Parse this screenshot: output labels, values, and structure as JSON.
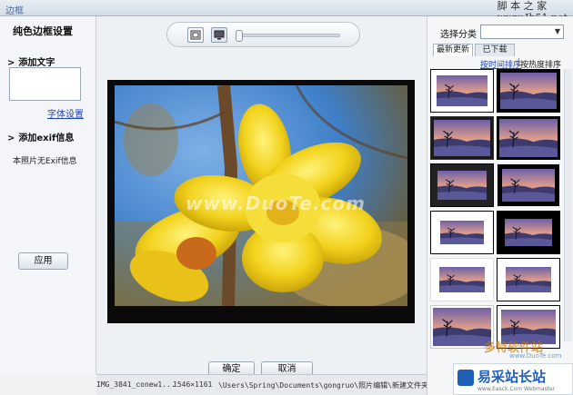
{
  "window": {
    "title": "边框"
  },
  "watermark_top": "脚 本 之 家\nwww.Jb51.net",
  "left_panel": {
    "heading": "纯色边框设置",
    "add_text_label": "添加文字",
    "font_settings_link": "字体设置",
    "add_exif_label": "添加exif信息",
    "exif_note": "本照片无Exif信息",
    "apply_button": "应用"
  },
  "toolbar": {
    "fit_icon": "fit-to-window-icon",
    "actual_size_icon": "monitor-icon",
    "zoom_fraction": 0.0
  },
  "preview": {
    "photo_watermark": "www.DuoTe.com"
  },
  "dialog_buttons": {
    "ok": "确定",
    "cancel": "取消"
  },
  "status_bar": {
    "filename": "IMG_3841_conew1...",
    "dimensions": "1546×1161",
    "path": "\\Users\\Spring\\Documents\\gongruo\\照片编辑\\新建文件夹 (2"
  },
  "right_panel": {
    "category_label": "选择分类",
    "tabs": [
      "最新更新",
      "已下载"
    ],
    "sort_by_time": "按时间排序",
    "sort_separator": "|",
    "sort_by_popularity": "按热度排序"
  },
  "footer_logos": {
    "duote_name": "多特软件站",
    "duote_url": "www.DuoTe.com",
    "yicai_name": "易采站长站",
    "yicai_url": "www.Easck.Com Webmaster"
  },
  "colors": {
    "accent_link": "#2244bb",
    "photo_frame": "#0a0a0a"
  }
}
